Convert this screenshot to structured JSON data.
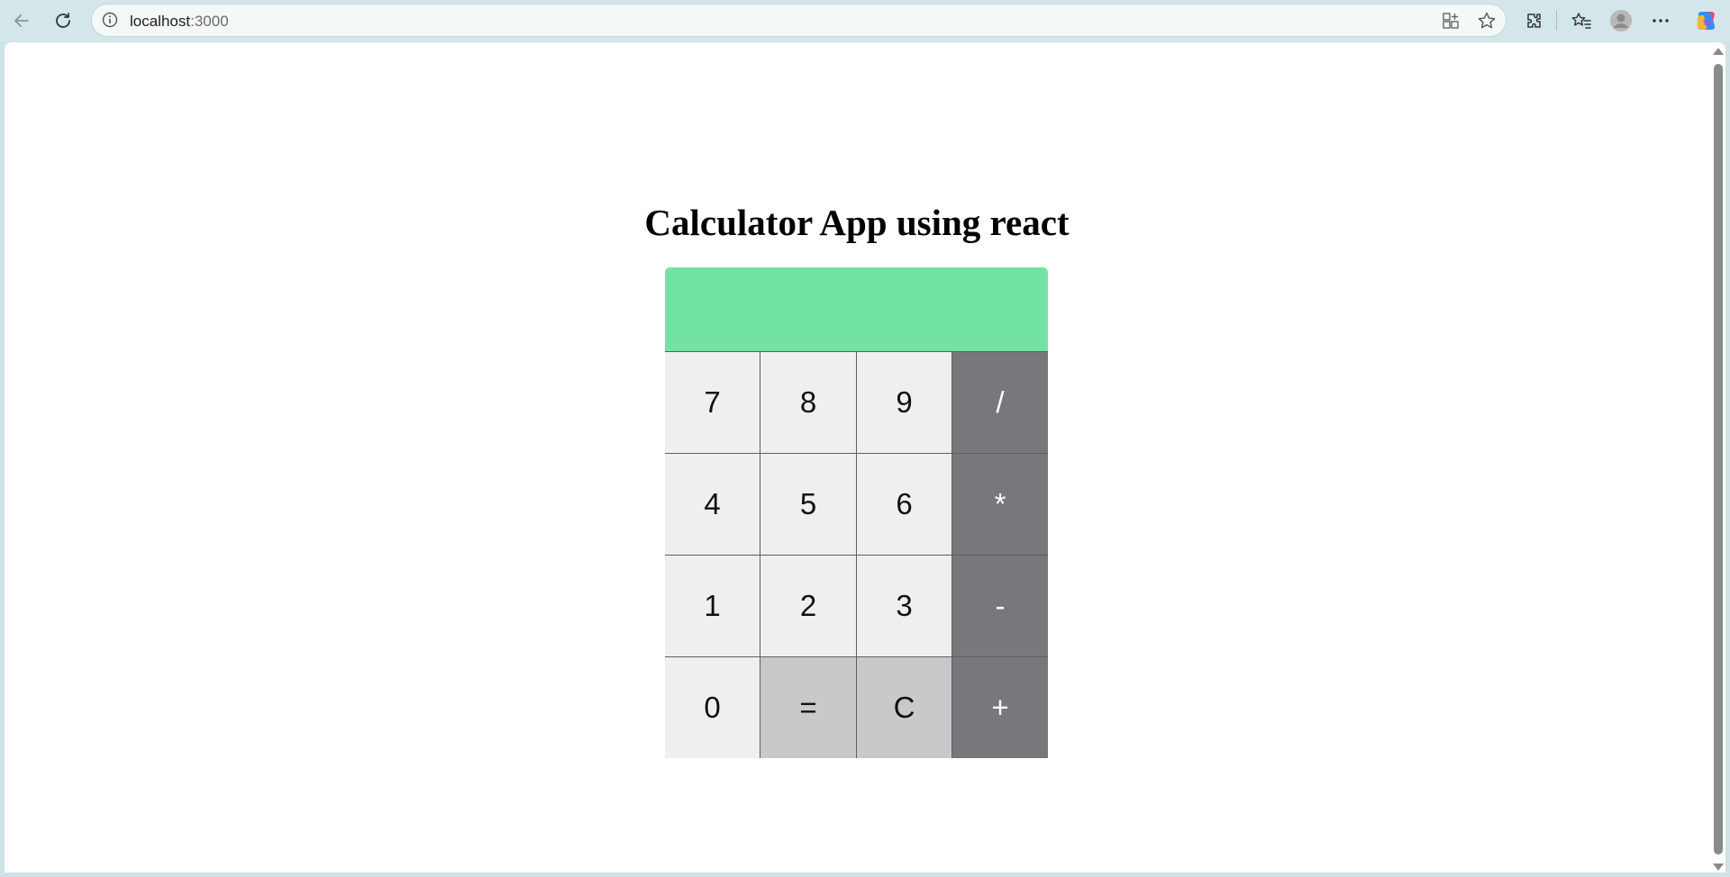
{
  "browser": {
    "url_host": "localhost",
    "url_port": ":3000"
  },
  "page": {
    "title": "Calculator App using react",
    "display_value": ""
  },
  "keys": {
    "k7": "7",
    "k8": "8",
    "k9": "9",
    "div": "/",
    "k4": "4",
    "k5": "5",
    "k6": "6",
    "mul": "*",
    "k1": "1",
    "k2": "2",
    "k3": "3",
    "sub": "-",
    "k0": "0",
    "eq": "=",
    "clear": "C",
    "add": "+"
  },
  "colors": {
    "display": "#73e3a3",
    "digit_key": "#efefef",
    "operator_key": "#78777b",
    "function_key": "#c9c9cc"
  }
}
